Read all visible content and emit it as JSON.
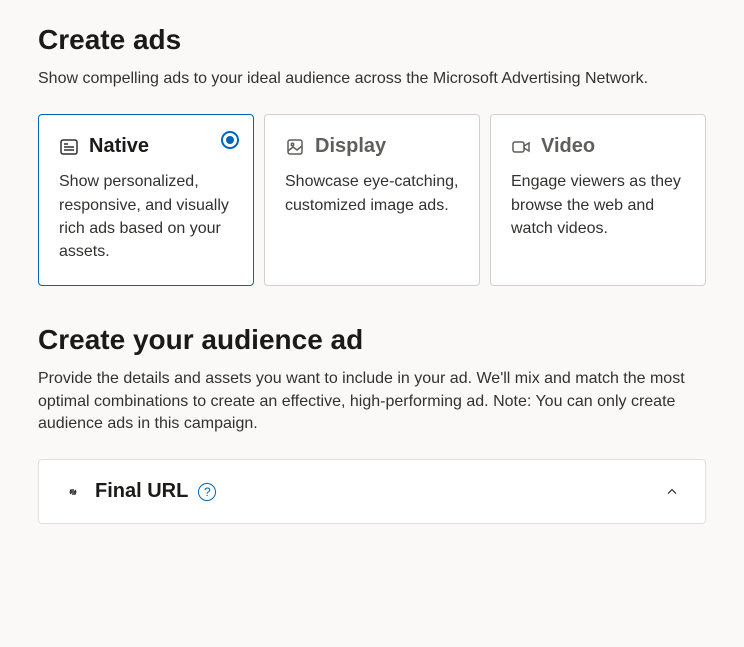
{
  "header": {
    "title": "Create ads",
    "subtitle": "Show compelling ads to your ideal audience across the Microsoft Advertising Network."
  },
  "ad_types": [
    {
      "id": "native",
      "title": "Native",
      "desc": "Show personalized, responsive, and visually rich ads based on your assets.",
      "selected": true
    },
    {
      "id": "display",
      "title": "Display",
      "desc": "Showcase eye-catching, customized image ads.",
      "selected": false
    },
    {
      "id": "video",
      "title": "Video",
      "desc": "Engage viewers as they browse the web and watch videos.",
      "selected": false
    }
  ],
  "section": {
    "title": "Create your audience ad",
    "subtitle": "Provide the details and assets you want to include in your ad. We'll mix and match the most optimal combinations to create an effective, high-performing ad. Note: You can only create audience ads in this campaign."
  },
  "final_url": {
    "label": "Final URL",
    "expanded": true,
    "help": "?"
  }
}
